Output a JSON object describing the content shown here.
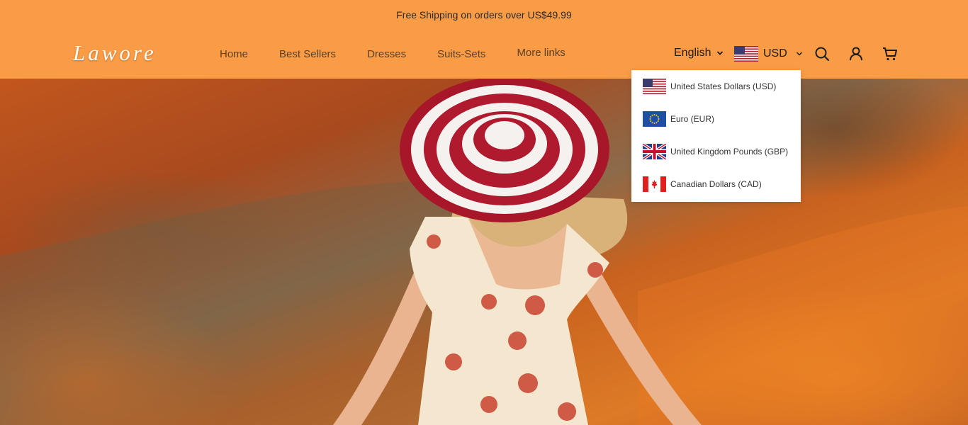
{
  "announcement": "Free Shipping on orders over US$49.99",
  "brand": {
    "logo": "Lawore"
  },
  "nav": [
    "Home",
    "Best Sellers",
    "Dresses",
    "Suits-Sets",
    "More links"
  ],
  "header": {
    "language": "English",
    "currency": "USD",
    "icons": [
      "search-icon",
      "account-icon",
      "cart-icon"
    ]
  },
  "currency_menu": {
    "open": true,
    "options": [
      {
        "label": "United States Dollars (USD)",
        "flag": "us-flag-icon"
      },
      {
        "label": "Euro (EUR)",
        "flag": "eu-flag-icon"
      },
      {
        "label": "United Kingdom Pounds (GBP)",
        "flag": "uk-flag-icon"
      },
      {
        "label": "Canadian Dollars (CAD)",
        "flag": "ca-flag-icon"
      }
    ]
  },
  "colors": {
    "header_bg": "#fa9b45",
    "text_dark": "#1c1c1c",
    "nav_text": "#5a4128",
    "logo": "#ffffff"
  },
  "hero": {
    "image": "woman-in-striped-sun-hat-and-floral-dress-in-poppy-field"
  }
}
